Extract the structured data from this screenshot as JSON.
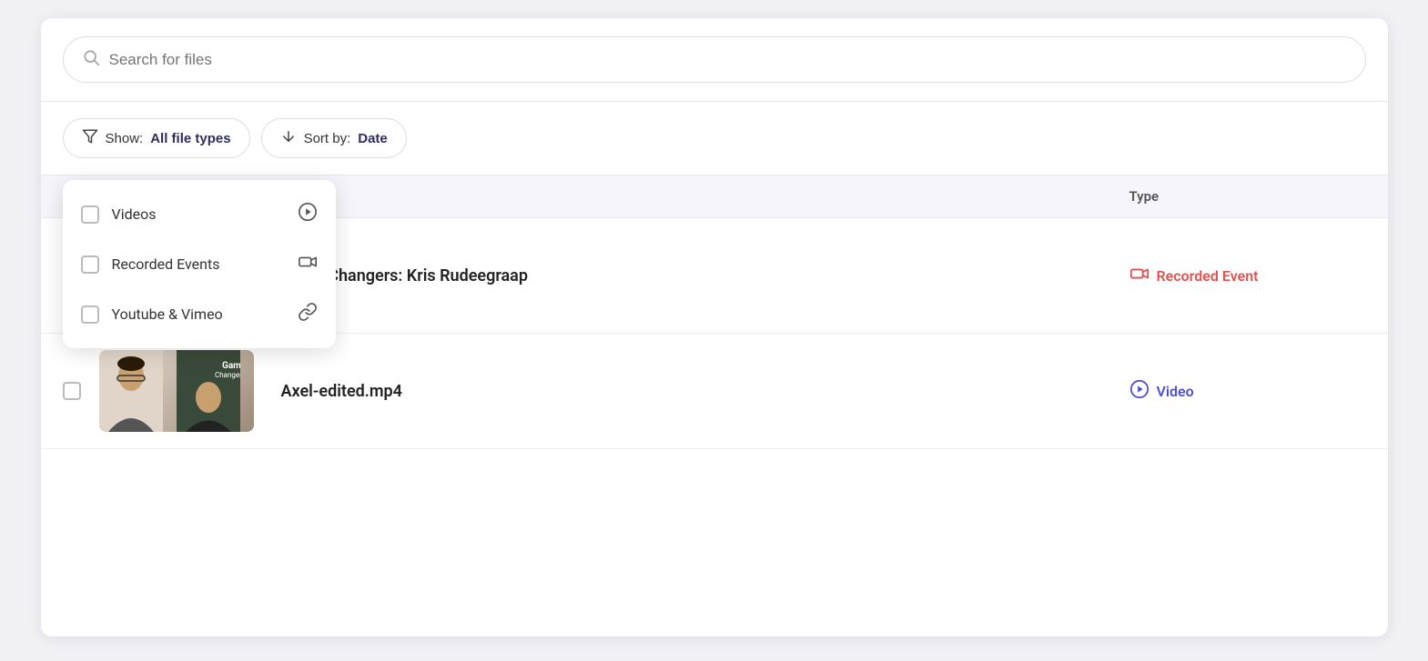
{
  "search": {
    "placeholder": "Search for files"
  },
  "filter_bar": {
    "show_label": "Show:",
    "show_value": "All file types",
    "sort_label": "Sort by:",
    "sort_value": "Date",
    "filter_icon": "▼",
    "sort_icon": "↓"
  },
  "dropdown": {
    "items": [
      {
        "id": "videos",
        "label": "Videos",
        "checked": false
      },
      {
        "id": "recorded-events",
        "label": "Recorded Events",
        "checked": false
      },
      {
        "id": "youtube-vimeo",
        "label": "Youtube & Vimeo",
        "checked": false
      }
    ]
  },
  "table": {
    "header": {
      "type_label": "Type"
    },
    "rows": [
      {
        "id": "row-1",
        "name": "Game Changers: Kris Rudeegraap",
        "type": "Recorded Event",
        "type_class": "recorded"
      },
      {
        "id": "row-2",
        "name": "Axel-edited.mp4",
        "type": "Video",
        "type_class": "video"
      }
    ]
  }
}
